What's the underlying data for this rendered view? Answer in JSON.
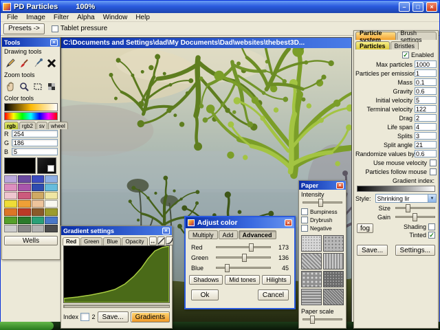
{
  "icons": {
    "close": "×",
    "minimize": "–",
    "maximize": "□",
    "check": "✓",
    "dropdown": "▼",
    "arrows_lr": "↔"
  },
  "window": {
    "title": "PD Particles",
    "zoom": "100%",
    "menus": [
      "File",
      "Image",
      "Filter",
      "Alpha",
      "Window",
      "Help"
    ]
  },
  "toolbar": {
    "presets_label": "Presets ->",
    "tablet_pressure_label": "Tablet pressure"
  },
  "tools_panel": {
    "title": "Tools",
    "drawing_tools_label": "Drawing tools",
    "zoom_tools_label": "Zoom tools",
    "color_tools_label": "Color tools",
    "color_tabs": [
      "rgb",
      "rgb2",
      "sv",
      "wheel"
    ],
    "channels": [
      {
        "label": "R",
        "value": "254"
      },
      {
        "label": "G",
        "value": "186"
      },
      {
        "label": "B",
        "value": "5"
      }
    ],
    "palette_colors": [
      "#b9a7dc",
      "#6b4aa0",
      "#3c4cc0",
      "#8fb0e4",
      "#de8fc0",
      "#a955ab",
      "#2e4cb0",
      "#66bcdc",
      "#eec6cf",
      "#cc5a7c",
      "#cfa963",
      "#efe6a2",
      "#efdc36",
      "#ef9f36",
      "#eec49b",
      "#f8f7ef",
      "#dd7626",
      "#bb3a26",
      "#8a5a2a",
      "#9c9c2c",
      "#55a02a",
      "#2a7a2a",
      "#2aa077",
      "#4a78c8",
      "#cccccc",
      "#8a8a8a",
      "#b2b2b2",
      "#4c4c4c"
    ],
    "wells_label": "Wells"
  },
  "canvas": {
    "title": "C:\\Documents and Settings\\dad\\My Documents\\Dad\\websites\\thebest3D..."
  },
  "gradient_window": {
    "title": "Gradient settings",
    "tabs": [
      "Red",
      "Green",
      "Blue",
      "Opacity"
    ],
    "index_label": "Index",
    "index_value": "2",
    "save_label": "Save...",
    "gradients_label": "Gradients"
  },
  "adjust_color": {
    "title": "Adjust color",
    "tabs": [
      "Multiply",
      "Add",
      "Advanced"
    ],
    "sliders": [
      {
        "label": "Red",
        "value": "173"
      },
      {
        "label": "Green",
        "value": "136"
      },
      {
        "label": "Blue",
        "value": "45"
      }
    ],
    "range_buttons": [
      "Shadows",
      "Mid tones",
      "Hilights"
    ],
    "ok_label": "Ok",
    "cancel_label": "Cancel"
  },
  "paper_panel": {
    "title": "Paper",
    "intensity_label": "Intensity",
    "options": [
      "Bumpiness",
      "Drybrush",
      "Negative"
    ],
    "scale_label": "Paper scale"
  },
  "particle_panel": {
    "tabs": [
      "Particle system",
      "Brush settings"
    ],
    "sub_tabs": [
      "Particles",
      "Bristles"
    ],
    "enabled_label": "Enabled",
    "fields": [
      {
        "label": "Max particles",
        "value": "1000"
      },
      {
        "label": "Particles per emission",
        "value": "1"
      },
      {
        "label": "Mass",
        "value": "0.1"
      },
      {
        "label": "Gravity",
        "value": "0.6"
      },
      {
        "label": "Initial velocity",
        "value": "5"
      },
      {
        "label": "Terminal velocity",
        "value": "122"
      },
      {
        "label": "Drag",
        "value": "2"
      },
      {
        "label": "Life span",
        "value": "4"
      },
      {
        "label": "Splits",
        "value": "3"
      },
      {
        "label": "Split angle",
        "value": "21"
      },
      {
        "label": "Randomize values by",
        "value": "0.6"
      }
    ],
    "mouse_options": [
      "Use mouse velocity",
      "Particles follow mouse"
    ],
    "gradient_index_label": "Gradient index:",
    "style_label": "Style:",
    "style_value": "Shrinking lir",
    "size_label": "Size",
    "gain_label": "Gain",
    "fog_label": "fog",
    "shading_label": "Shading",
    "tinted_label": "Tinted",
    "save_label": "Save...",
    "settings_label": "Settings..."
  }
}
